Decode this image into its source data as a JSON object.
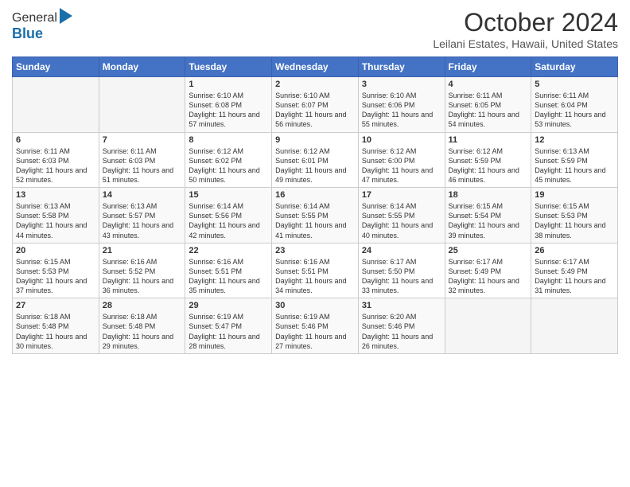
{
  "header": {
    "logo_line1": "General",
    "logo_line2": "Blue",
    "title": "October 2024",
    "subtitle": "Leilani Estates, Hawaii, United States"
  },
  "days_of_week": [
    "Sunday",
    "Monday",
    "Tuesday",
    "Wednesday",
    "Thursday",
    "Friday",
    "Saturday"
  ],
  "weeks": [
    [
      {
        "day": "",
        "sunrise": "",
        "sunset": "",
        "daylight": ""
      },
      {
        "day": "",
        "sunrise": "",
        "sunset": "",
        "daylight": ""
      },
      {
        "day": "1",
        "sunrise": "Sunrise: 6:10 AM",
        "sunset": "Sunset: 6:08 PM",
        "daylight": "Daylight: 11 hours and 57 minutes."
      },
      {
        "day": "2",
        "sunrise": "Sunrise: 6:10 AM",
        "sunset": "Sunset: 6:07 PM",
        "daylight": "Daylight: 11 hours and 56 minutes."
      },
      {
        "day": "3",
        "sunrise": "Sunrise: 6:10 AM",
        "sunset": "Sunset: 6:06 PM",
        "daylight": "Daylight: 11 hours and 55 minutes."
      },
      {
        "day": "4",
        "sunrise": "Sunrise: 6:11 AM",
        "sunset": "Sunset: 6:05 PM",
        "daylight": "Daylight: 11 hours and 54 minutes."
      },
      {
        "day": "5",
        "sunrise": "Sunrise: 6:11 AM",
        "sunset": "Sunset: 6:04 PM",
        "daylight": "Daylight: 11 hours and 53 minutes."
      }
    ],
    [
      {
        "day": "6",
        "sunrise": "Sunrise: 6:11 AM",
        "sunset": "Sunset: 6:03 PM",
        "daylight": "Daylight: 11 hours and 52 minutes."
      },
      {
        "day": "7",
        "sunrise": "Sunrise: 6:11 AM",
        "sunset": "Sunset: 6:03 PM",
        "daylight": "Daylight: 11 hours and 51 minutes."
      },
      {
        "day": "8",
        "sunrise": "Sunrise: 6:12 AM",
        "sunset": "Sunset: 6:02 PM",
        "daylight": "Daylight: 11 hours and 50 minutes."
      },
      {
        "day": "9",
        "sunrise": "Sunrise: 6:12 AM",
        "sunset": "Sunset: 6:01 PM",
        "daylight": "Daylight: 11 hours and 49 minutes."
      },
      {
        "day": "10",
        "sunrise": "Sunrise: 6:12 AM",
        "sunset": "Sunset: 6:00 PM",
        "daylight": "Daylight: 11 hours and 47 minutes."
      },
      {
        "day": "11",
        "sunrise": "Sunrise: 6:12 AM",
        "sunset": "Sunset: 5:59 PM",
        "daylight": "Daylight: 11 hours and 46 minutes."
      },
      {
        "day": "12",
        "sunrise": "Sunrise: 6:13 AM",
        "sunset": "Sunset: 5:59 PM",
        "daylight": "Daylight: 11 hours and 45 minutes."
      }
    ],
    [
      {
        "day": "13",
        "sunrise": "Sunrise: 6:13 AM",
        "sunset": "Sunset: 5:58 PM",
        "daylight": "Daylight: 11 hours and 44 minutes."
      },
      {
        "day": "14",
        "sunrise": "Sunrise: 6:13 AM",
        "sunset": "Sunset: 5:57 PM",
        "daylight": "Daylight: 11 hours and 43 minutes."
      },
      {
        "day": "15",
        "sunrise": "Sunrise: 6:14 AM",
        "sunset": "Sunset: 5:56 PM",
        "daylight": "Daylight: 11 hours and 42 minutes."
      },
      {
        "day": "16",
        "sunrise": "Sunrise: 6:14 AM",
        "sunset": "Sunset: 5:55 PM",
        "daylight": "Daylight: 11 hours and 41 minutes."
      },
      {
        "day": "17",
        "sunrise": "Sunrise: 6:14 AM",
        "sunset": "Sunset: 5:55 PM",
        "daylight": "Daylight: 11 hours and 40 minutes."
      },
      {
        "day": "18",
        "sunrise": "Sunrise: 6:15 AM",
        "sunset": "Sunset: 5:54 PM",
        "daylight": "Daylight: 11 hours and 39 minutes."
      },
      {
        "day": "19",
        "sunrise": "Sunrise: 6:15 AM",
        "sunset": "Sunset: 5:53 PM",
        "daylight": "Daylight: 11 hours and 38 minutes."
      }
    ],
    [
      {
        "day": "20",
        "sunrise": "Sunrise: 6:15 AM",
        "sunset": "Sunset: 5:53 PM",
        "daylight": "Daylight: 11 hours and 37 minutes."
      },
      {
        "day": "21",
        "sunrise": "Sunrise: 6:16 AM",
        "sunset": "Sunset: 5:52 PM",
        "daylight": "Daylight: 11 hours and 36 minutes."
      },
      {
        "day": "22",
        "sunrise": "Sunrise: 6:16 AM",
        "sunset": "Sunset: 5:51 PM",
        "daylight": "Daylight: 11 hours and 35 minutes."
      },
      {
        "day": "23",
        "sunrise": "Sunrise: 6:16 AM",
        "sunset": "Sunset: 5:51 PM",
        "daylight": "Daylight: 11 hours and 34 minutes."
      },
      {
        "day": "24",
        "sunrise": "Sunrise: 6:17 AM",
        "sunset": "Sunset: 5:50 PM",
        "daylight": "Daylight: 11 hours and 33 minutes."
      },
      {
        "day": "25",
        "sunrise": "Sunrise: 6:17 AM",
        "sunset": "Sunset: 5:49 PM",
        "daylight": "Daylight: 11 hours and 32 minutes."
      },
      {
        "day": "26",
        "sunrise": "Sunrise: 6:17 AM",
        "sunset": "Sunset: 5:49 PM",
        "daylight": "Daylight: 11 hours and 31 minutes."
      }
    ],
    [
      {
        "day": "27",
        "sunrise": "Sunrise: 6:18 AM",
        "sunset": "Sunset: 5:48 PM",
        "daylight": "Daylight: 11 hours and 30 minutes."
      },
      {
        "day": "28",
        "sunrise": "Sunrise: 6:18 AM",
        "sunset": "Sunset: 5:48 PM",
        "daylight": "Daylight: 11 hours and 29 minutes."
      },
      {
        "day": "29",
        "sunrise": "Sunrise: 6:19 AM",
        "sunset": "Sunset: 5:47 PM",
        "daylight": "Daylight: 11 hours and 28 minutes."
      },
      {
        "day": "30",
        "sunrise": "Sunrise: 6:19 AM",
        "sunset": "Sunset: 5:46 PM",
        "daylight": "Daylight: 11 hours and 27 minutes."
      },
      {
        "day": "31",
        "sunrise": "Sunrise: 6:20 AM",
        "sunset": "Sunset: 5:46 PM",
        "daylight": "Daylight: 11 hours and 26 minutes."
      },
      {
        "day": "",
        "sunrise": "",
        "sunset": "",
        "daylight": ""
      },
      {
        "day": "",
        "sunrise": "",
        "sunset": "",
        "daylight": ""
      }
    ]
  ]
}
